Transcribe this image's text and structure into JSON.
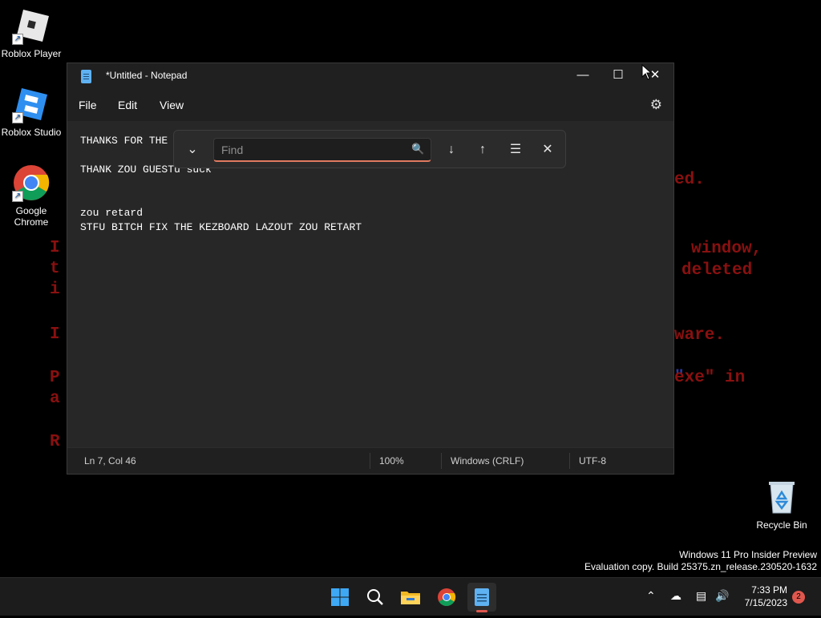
{
  "desktop": {
    "icons": [
      {
        "label": "Roblox Player"
      },
      {
        "label": "Roblox Studio"
      },
      {
        "label": "Google Chrome"
      },
      {
        "label": "Recycle Bin"
      }
    ],
    "wallpaper_fragments": [
      "ed.",
      "window,",
      "deleted",
      "ware.",
      "exe\" in"
    ],
    "watermark": {
      "line1": "Windows 11 Pro Insider Preview",
      "line2": "Evaluation copy. Build 25375.zn_release.230520-1632"
    }
  },
  "notepad": {
    "title": "*Untitled - Notepad",
    "menu": [
      "File",
      "Edit",
      "View"
    ],
    "lines": [
      "THANKS FOR THE",
      "THANK ZOU GUESTu suck",
      "zou retard",
      "STFU BITCH FIX THE KEZBOARD LAZOUT ZOU RETART"
    ],
    "find": {
      "placeholder": "Find",
      "value": ""
    },
    "status": {
      "position": "Ln 7, Col 46",
      "zoom": "100%",
      "line_ending": "Windows (CRLF)",
      "encoding": "UTF-8"
    }
  },
  "taskbar": {
    "apps": [
      "start-icon",
      "search-icon",
      "file-explorer-icon",
      "chrome-icon",
      "notepad-icon"
    ],
    "clock": {
      "time": "7:33 PM",
      "date": "7/15/2023"
    },
    "notification_count": "2"
  }
}
